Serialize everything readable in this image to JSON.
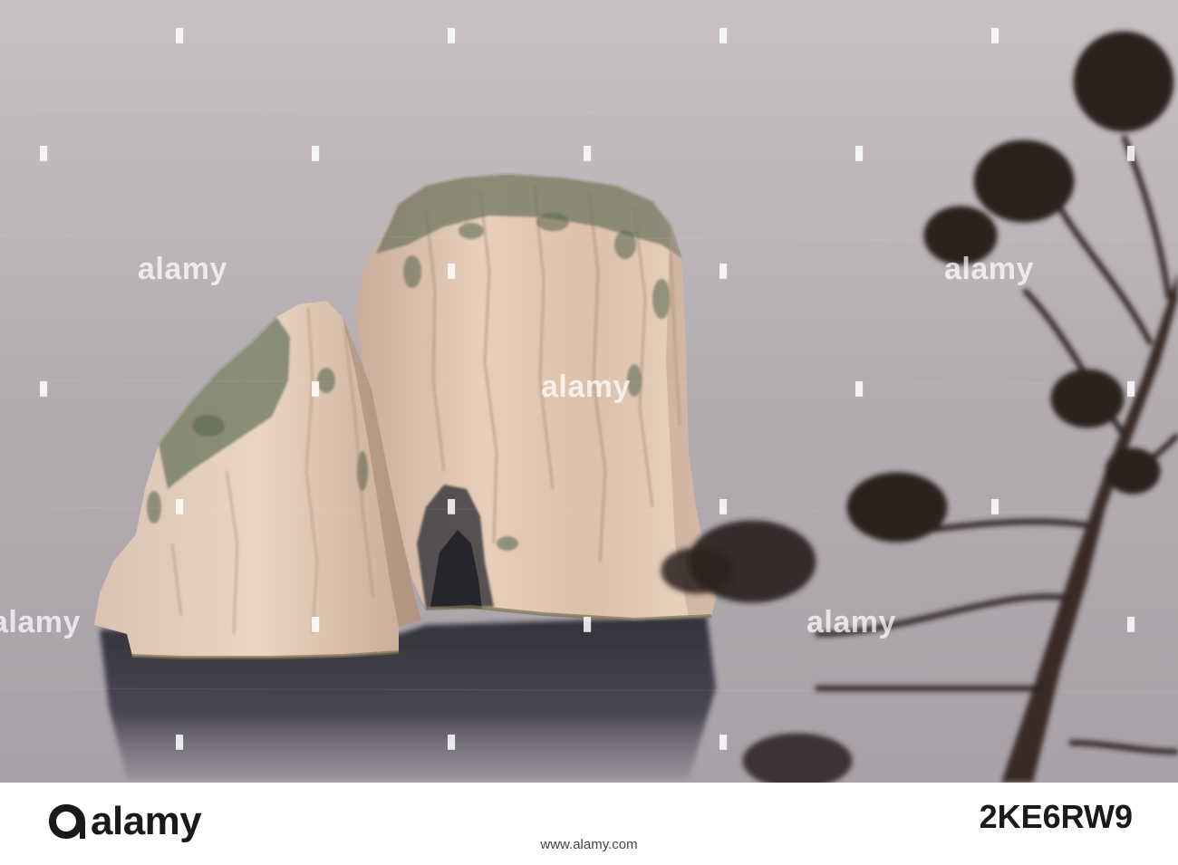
{
  "photo": {
    "subject": "Faraglioni sea stacks, Capri",
    "colors": {
      "sea": "#b9b3b7",
      "sea_dark": "#3e3b44",
      "rock_light": "#e6cdb6",
      "rock_shadow": "#a98c7a",
      "plant_silhouette": "#2a211d"
    }
  },
  "watermark": {
    "text": "alamy"
  },
  "footer": {
    "brand": "alamy",
    "image_id": "2KE6RW9",
    "url": "www.alamy.com"
  }
}
